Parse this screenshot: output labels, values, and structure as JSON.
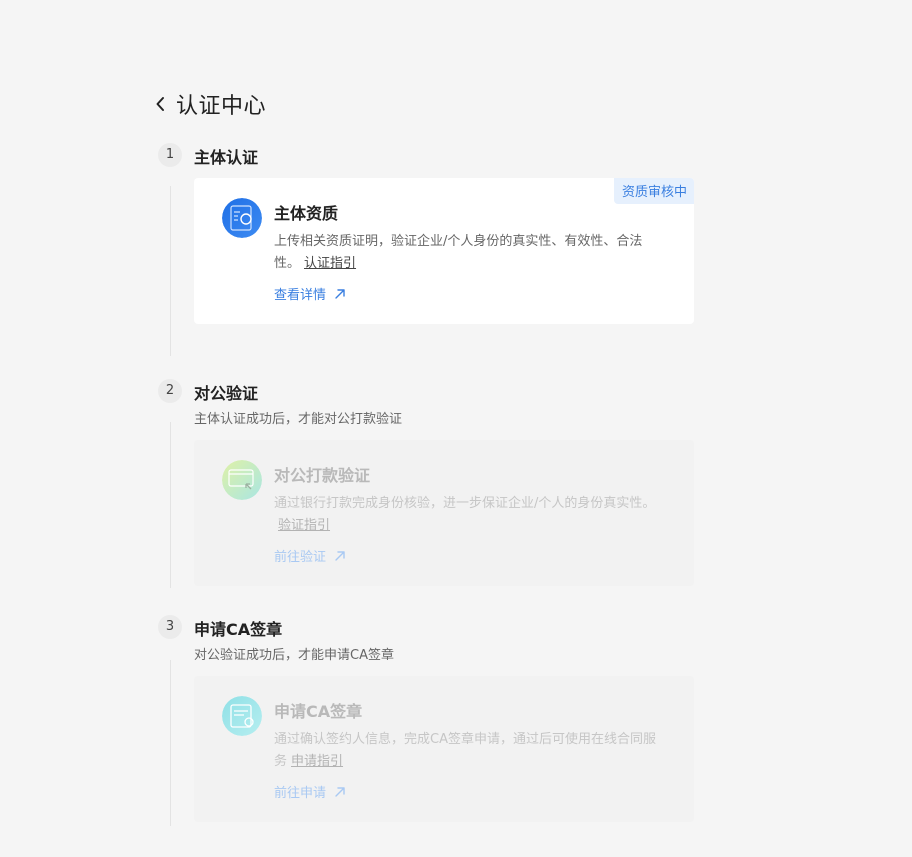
{
  "header": {
    "title": "认证中心"
  },
  "steps": [
    {
      "number": "1",
      "title": "主体认证",
      "subtitle": "",
      "card": {
        "badge": "资质审核中",
        "icon": "id-document-icon",
        "title": "主体资质",
        "desc": "上传相关资质证明，验证企业/个人身份的真实性、有效性、合法性。",
        "guide": "认证指引",
        "action": "查看详情"
      }
    },
    {
      "number": "2",
      "title": "对公验证",
      "subtitle": "主体认证成功后，才能对公打款验证",
      "card": {
        "icon": "bank-card-icon",
        "title": "对公打款验证",
        "desc": "通过银行打款完成身份核验，进一步保证企业/个人的身份真实性。",
        "guide": "验证指引",
        "action": "前往验证"
      }
    },
    {
      "number": "3",
      "title": "申请CA签章",
      "subtitle": "对公验证成功后，才能申请CA签章",
      "card": {
        "icon": "certificate-icon",
        "title": "申请CA签章",
        "desc": "通过确认签约人信息，完成CA签章申请，通过后可使用在线合同服务",
        "guide": "申请指引",
        "action": "前往申请"
      }
    }
  ],
  "colors": {
    "accent": "#3a7fe0",
    "badge_bg": "#e6f0fd",
    "page_bg": "#f5f5f5"
  }
}
